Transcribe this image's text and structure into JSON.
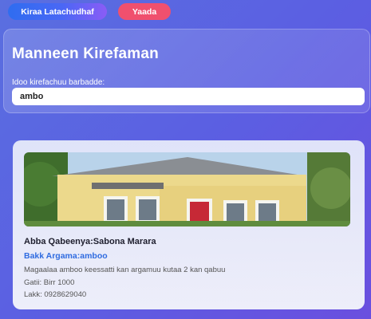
{
  "topbar": {
    "home_label": "Kiraa Latachudhaf",
    "logout_label": "Yaada"
  },
  "search": {
    "title": "Manneen Kirefaman",
    "label": "Idoo kirefachuu barbadde:",
    "value": "ambo"
  },
  "result": {
    "owner": "Abba Qabeenya:Sabona Marara",
    "location": "Bakk Argama:amboo",
    "description": "Magaalaa amboo keessatti kan argamuu kutaa 2 kan qabuu",
    "price": "Gatii: Birr 1000",
    "phone": "Lakk: 0928629040"
  }
}
